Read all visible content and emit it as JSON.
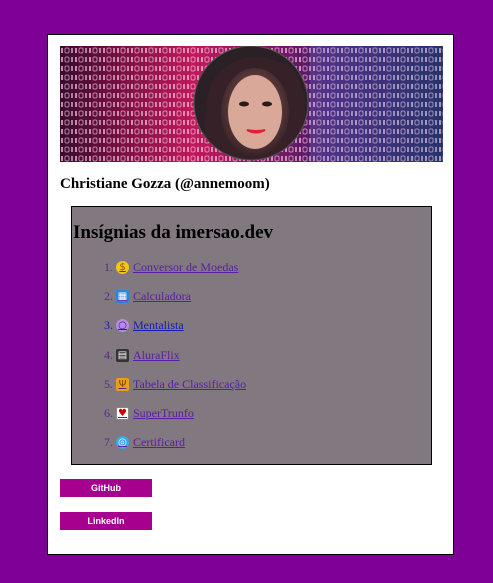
{
  "profile": {
    "name": "Christiane Gozza (@annemoom)"
  },
  "badges": {
    "title": "Insígnias da imersao.dev",
    "items": [
      {
        "number": "1.",
        "label": " Conversor de Moedas",
        "icon": "medal-icon"
      },
      {
        "number": "2.",
        "label": " Calculadora",
        "icon": "calculator-icon"
      },
      {
        "number": "3.",
        "label": " Mentalista",
        "icon": "crystal-ball-icon"
      },
      {
        "number": "4.",
        "label": " AluraFlix",
        "icon": "clapperboard-icon"
      },
      {
        "number": "5.",
        "label": " Tabela de Classificação",
        "icon": "trophy-icon"
      },
      {
        "number": "6.",
        "label": " SuperTrunfo",
        "icon": "playing-card-icon"
      },
      {
        "number": "7.",
        "label": " Certificard",
        "icon": "globe-icon"
      }
    ]
  },
  "links": {
    "github": "GitHub",
    "linkedin": "LinkedIn"
  },
  "colors": {
    "page_background": "#7f0097",
    "badge_panel": "#817880",
    "button": "#a7008f",
    "link": "#5b1ca6"
  }
}
